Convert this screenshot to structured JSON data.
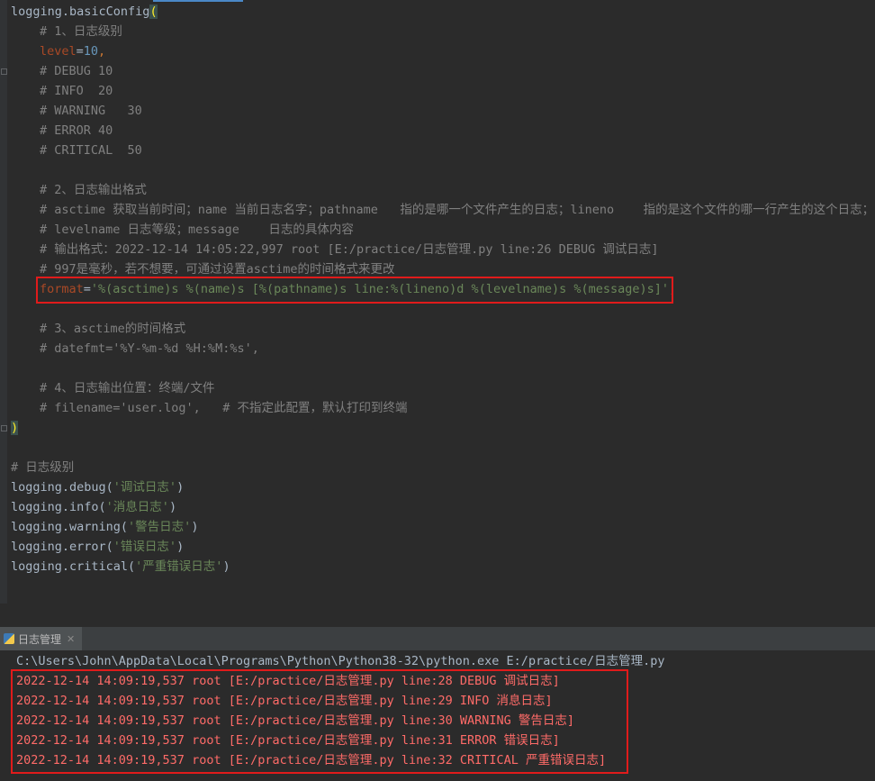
{
  "editor": {
    "lines": [
      {
        "id": "l0",
        "t": "logging.basicConfig"
      },
      {
        "id": "l1",
        "t": "# 1、日志级别"
      },
      {
        "id": "l2a",
        "t": "level"
      },
      {
        "id": "l2b",
        "t": "10"
      },
      {
        "id": "l3",
        "t": "# DEBUG 10"
      },
      {
        "id": "l4",
        "t": "# INFO  20"
      },
      {
        "id": "l5",
        "t": "# WARNING   30"
      },
      {
        "id": "l6",
        "t": "# ERROR 40"
      },
      {
        "id": "l7",
        "t": "# CRITICAL  50"
      },
      {
        "id": "l9",
        "t": "# 2、日志输出格式"
      },
      {
        "id": "l10",
        "t": "# asctime 获取当前时间；name 当前日志名字；pathname   指的是哪一个文件产生的日志；lineno    指的是这个文件的哪一行产生的这个日志；"
      },
      {
        "id": "l11",
        "t": "# levelname 日志等级；message    日志的具体内容"
      },
      {
        "id": "l12",
        "t": "# 输出格式：2022-12-14 14:05:22,997 root [E:/practice/日志管理.py line:26 DEBUG 调试日志]"
      },
      {
        "id": "l13",
        "t": "# 997是毫秒，若不想要，可通过设置asctime的时间格式来更改"
      },
      {
        "id": "l14a",
        "t": "format"
      },
      {
        "id": "l14b",
        "t": "'%(asctime)s %(name)s [%(pathname)s line:%(lineno)d %(levelname)s %(message)s]'"
      },
      {
        "id": "l16",
        "t": "# 3、asctime的时间格式"
      },
      {
        "id": "l17",
        "t": "# datefmt='%Y-%m-%d %H:%M:%s',"
      },
      {
        "id": "l19",
        "t": "# 4、日志输出位置：终端/文件"
      },
      {
        "id": "l20",
        "t": "# filename='user.log',   # 不指定此配置，默认打印到终端"
      },
      {
        "id": "l21",
        "t": ")"
      },
      {
        "id": "l23",
        "t": "# 日志级别"
      },
      {
        "id": "l24a",
        "t": "logging.debug("
      },
      {
        "id": "l24b",
        "t": "'调试日志'"
      },
      {
        "id": "l25a",
        "t": "logging.info("
      },
      {
        "id": "l25b",
        "t": "'消息日志'"
      },
      {
        "id": "l26a",
        "t": "logging.warning("
      },
      {
        "id": "l26b",
        "t": "'警告日志'"
      },
      {
        "id": "l27a",
        "t": "logging.error("
      },
      {
        "id": "l27b",
        "t": "'错误日志'"
      },
      {
        "id": "l28a",
        "t": "logging.critical("
      },
      {
        "id": "l28b",
        "t": "'严重错误日志'"
      }
    ]
  },
  "run_panel": {
    "tab_label": "日志管理",
    "command": "C:\\Users\\John\\AppData\\Local\\Programs\\Python\\Python38-32\\python.exe E:/practice/日志管理.py",
    "output": [
      "2022-12-14 14:09:19,537 root [E:/practice/日志管理.py line:28 DEBUG 调试日志]",
      "2022-12-14 14:09:19,537 root [E:/practice/日志管理.py line:29 INFO 消息日志]",
      "2022-12-14 14:09:19,537 root [E:/practice/日志管理.py line:30 WARNING 警告日志]",
      "2022-12-14 14:09:19,537 root [E:/practice/日志管理.py line:31 ERROR 错误日志]",
      "2022-12-14 14:09:19,537 root [E:/practice/日志管理.py line:32 CRITICAL 严重错误日志]"
    ]
  },
  "colors": {
    "background": "#2b2b2b",
    "comment": "#808080",
    "string": "#6a8759",
    "number": "#6897bb",
    "keyword": "#cc7832",
    "param": "#aa4926",
    "log_output": "#ff6b68",
    "highlight_box": "#e01b1b"
  }
}
